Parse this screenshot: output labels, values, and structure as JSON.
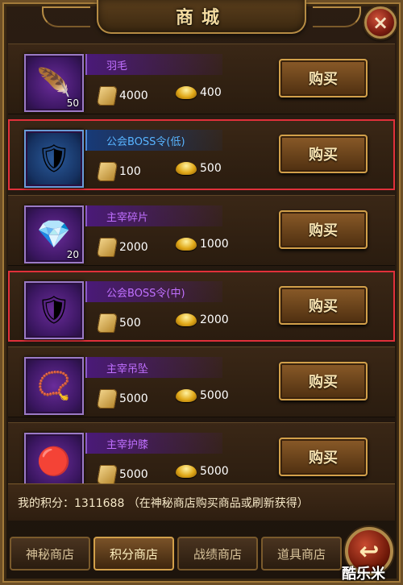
{
  "header": {
    "title": "商城",
    "close_label": "×"
  },
  "items": [
    {
      "name": "羽毛",
      "count": "50",
      "price_scroll": "4000",
      "price_ingot": "400",
      "buy_label": "购买",
      "icon": "feather-icon",
      "rarity": "purple"
    },
    {
      "name": "公会BOSS令(低)",
      "count": "",
      "price_scroll": "100",
      "price_ingot": "500",
      "buy_label": "购买",
      "icon": "boss-token-icon",
      "rarity": "blue"
    },
    {
      "name": "主宰碎片",
      "count": "20",
      "price_scroll": "2000",
      "price_ingot": "1000",
      "buy_label": "购买",
      "icon": "crystal-shard-icon",
      "rarity": "purple"
    },
    {
      "name": "公会BOSS令(中)",
      "count": "",
      "price_scroll": "500",
      "price_ingot": "2000",
      "buy_label": "购买",
      "icon": "boss-token-icon",
      "rarity": "purple"
    },
    {
      "name": "主宰吊坠",
      "count": "",
      "price_scroll": "5000",
      "price_ingot": "5000",
      "buy_label": "购买",
      "icon": "pendant-icon",
      "rarity": "purple"
    },
    {
      "name": "主宰护膝",
      "count": "",
      "price_scroll": "5000",
      "price_ingot": "5000",
      "buy_label": "购买",
      "icon": "kneepad-icon",
      "rarity": "purple"
    }
  ],
  "points": {
    "text": "我的积分：1311688  （在神秘商店购买商品或刷新获得）"
  },
  "tabs": [
    {
      "label": "神秘商店",
      "active": false
    },
    {
      "label": "积分商店",
      "active": true
    },
    {
      "label": "战绩商店",
      "active": false
    },
    {
      "label": "道具商店",
      "active": false
    }
  ],
  "back": {
    "label": "↩"
  },
  "watermark": "酷乐米",
  "colors": {
    "selection": "#e0303a",
    "purple_name": "#c070ff",
    "blue_name": "#58b4ff",
    "gold": "#d2a04a"
  }
}
